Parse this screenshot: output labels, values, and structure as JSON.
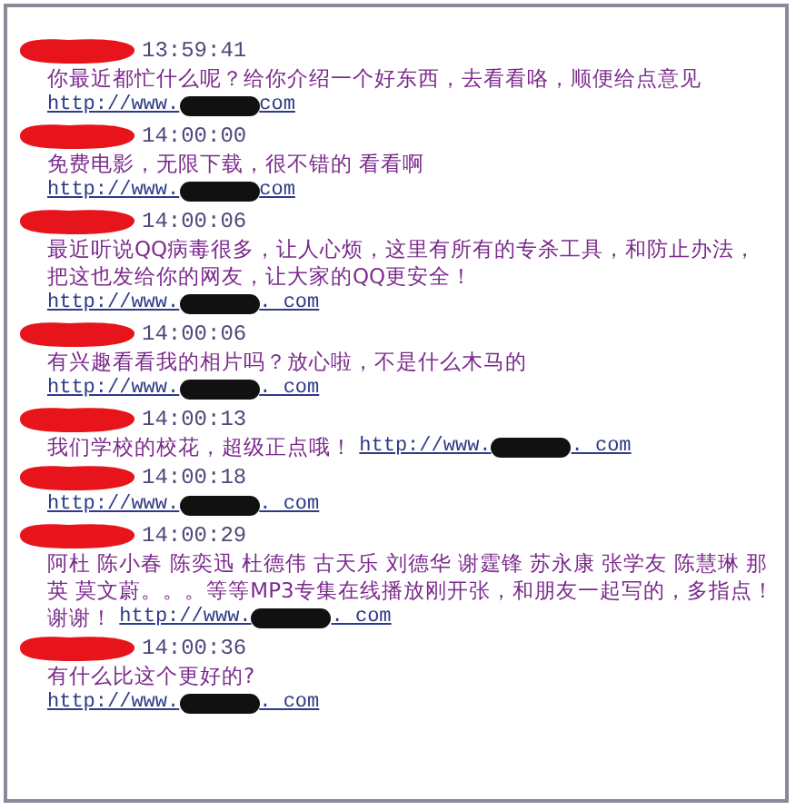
{
  "messages": [
    {
      "time": "13:59:41",
      "text": "你最近都忙什么呢？给你介绍一个好东西，去看看咯，顺便给点意见",
      "link": {
        "prefix": "http://www.",
        "suffix": "com"
      },
      "kind": "separate"
    },
    {
      "time": "14:00:00",
      "text": "免费电影，无限下载，很不错的 看看啊",
      "link": {
        "prefix": "http://www.",
        "suffix": "com"
      },
      "kind": "separate"
    },
    {
      "time": "14:00:06",
      "text": "最近听说QQ病毒很多，让人心烦，这里有所有的专杀工具，和防止办法，把这也发给你的网友，让大家的QQ更安全！",
      "link": {
        "prefix": "http://www.",
        "suffix": ". com"
      },
      "kind": "separate"
    },
    {
      "time": "14:00:06",
      "text": "有兴趣看看我的相片吗？放心啦，不是什么木马的",
      "link": {
        "prefix": "http://www.",
        "suffix": ". com"
      },
      "kind": "separate"
    },
    {
      "time": "14:00:13",
      "text": "我们学校的校花，超级正点哦！",
      "link": {
        "prefix": "http://www.",
        "suffix": ". com"
      },
      "kind": "inline"
    },
    {
      "time": "14:00:18",
      "link": {
        "prefix": "http://www.",
        "suffix": ". com"
      },
      "kind": "separate"
    },
    {
      "time": "14:00:29",
      "text": "阿杜 陈小春 陈奕迅 杜德伟 古天乐 刘德华 谢霆锋 苏永康 张学友 陈慧琳 那英 莫文蔚。。。等等MP3专集在线播放刚开张，和朋友一起写的，多指点！谢谢！",
      "link": {
        "prefix": "http://www.",
        "suffix": ". com"
      },
      "kind": "inline"
    },
    {
      "time": "14:00:36",
      "text": "有什么比这个更好的?",
      "link": {
        "prefix": "http://www.",
        "suffix": ". com"
      },
      "kind": "separate"
    }
  ]
}
